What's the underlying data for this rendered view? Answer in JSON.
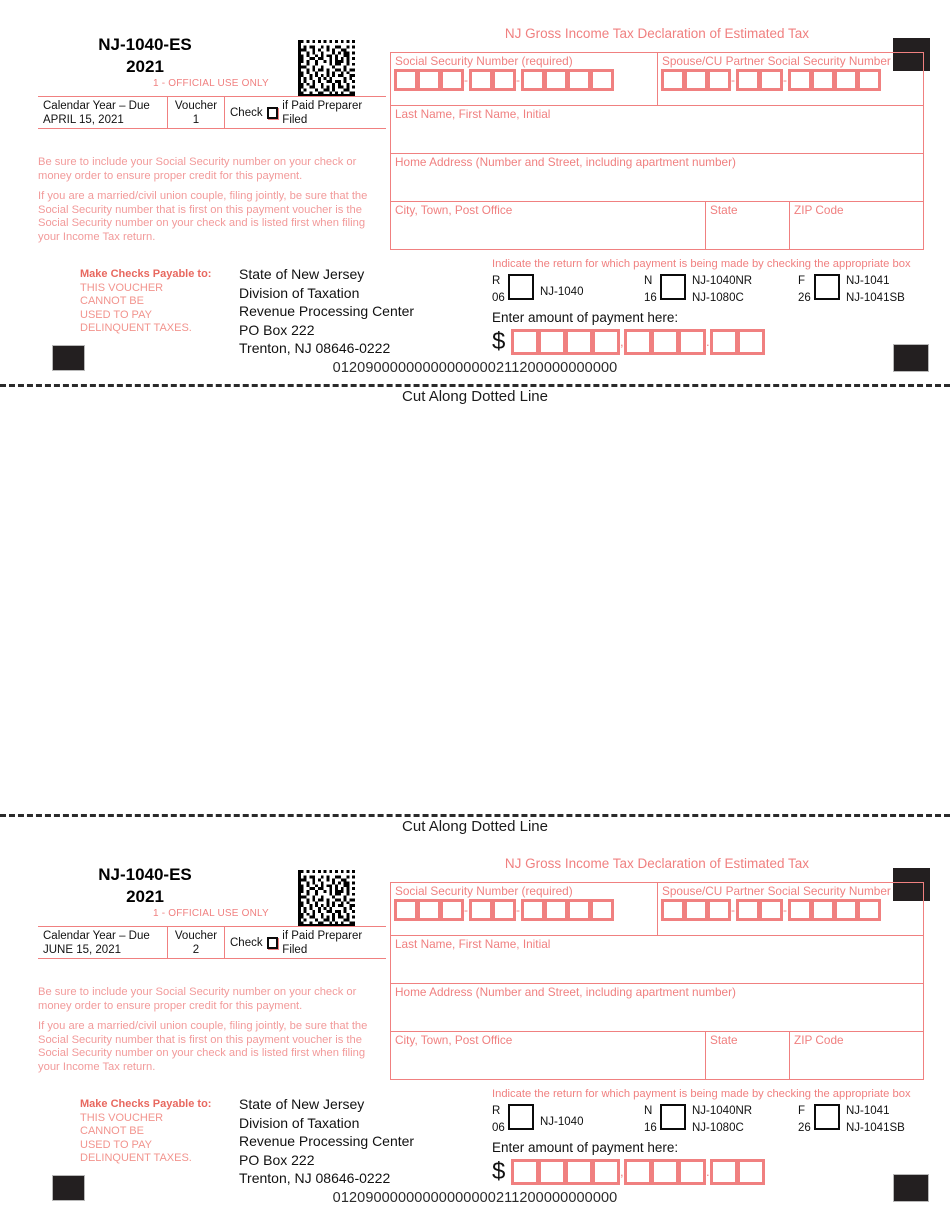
{
  "document": {
    "form_number": "NJ-1040-ES",
    "tax_year": "2021",
    "official_use": "1 - OFFICIAL USE ONLY",
    "cut_line_text": "Cut Along Dotted Line",
    "panel_heading": "NJ Gross Income Tax Declaration of Estimated Tax"
  },
  "info_strip": {
    "due_label": "Calendar Year – Due",
    "voucher_label": "Voucher",
    "preparer_prefix": "Check",
    "preparer_suffix": "if Paid Preparer Filed"
  },
  "notes": {
    "note_1": "Be sure to include your Social Security number on your check or money order to ensure proper credit for this payment.",
    "note_2": "If you are a married/civil union couple, filing jointly, be sure that the Social Security number that is first on this payment voucher is the Social Security number on your check and is listed first when filing your Income Tax return."
  },
  "payable": {
    "heading": "Make Checks Payable to:",
    "warning": "THIS VOUCHER CANNOT BE USED TO PAY DELINQUENT TAXES.",
    "warning_lines": [
      "THIS VOUCHER",
      "CANNOT BE",
      "USED TO PAY",
      "DELINQUENT TAXES."
    ],
    "address_lines": [
      "State of New Jersey",
      "Division of Taxation",
      "Revenue Processing Center",
      "PO Box 222",
      "Trenton, NJ 08646-0222"
    ]
  },
  "fields": {
    "ssn_label": "Social Security Number (required)",
    "spouse_ssn_label": "Spouse/CU Partner Social Security Number",
    "name_label": "Last Name, First Name, Initial",
    "address_label": "Home Address (Number and Street, including apartment number)",
    "city_label": "City, Town, Post Office",
    "state_label": "State",
    "zip_label": "ZIP Code",
    "ssn_value": "",
    "spouse_ssn_value": "",
    "name_value": "",
    "address_value": "",
    "city_value": "",
    "state_value": "",
    "zip_value": ""
  },
  "return_selection": {
    "instruction": "Indicate the return for which payment is being made by checking the appropriate box",
    "options": [
      {
        "letter": "R",
        "code": "06",
        "form_top": "",
        "form_bottom": "NJ-1040",
        "checked": false
      },
      {
        "letter": "N",
        "code": "16",
        "form_top": "NJ-1040NR",
        "form_bottom": "NJ-1080C",
        "checked": false
      },
      {
        "letter": "F",
        "code": "26",
        "form_top": "NJ-1041",
        "form_bottom": "NJ-1041SB",
        "checked": false
      }
    ]
  },
  "payment": {
    "label": "Enter amount of payment here:",
    "currency_symbol": "$",
    "thousands_separator": ",",
    "decimal_separator": ".",
    "value": ""
  },
  "vouchers": [
    {
      "number": "1",
      "due_date": "APRIL 15, 2021",
      "scanline": "01209000000000000000211200000000000"
    },
    {
      "number": "2",
      "due_date": "JUNE 15, 2021",
      "scanline": "01209000000000000000211200000000000"
    }
  ],
  "colors": {
    "form_pink": "#f08080",
    "note_pink": "#f29a9a",
    "payable_red": "#e8685f",
    "ink_black": "#111111",
    "reg_mark": "#231f20"
  },
  "icons": {
    "barcode": "datamatrix-2d-barcode"
  }
}
